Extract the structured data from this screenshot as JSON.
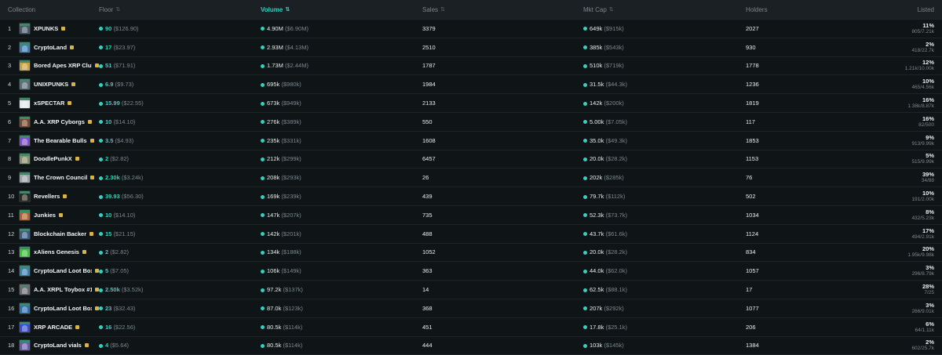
{
  "header": {
    "collection": "Collection",
    "floor": "Floor",
    "volume": "Volume",
    "sales": "Sales",
    "mcap": "Mkt Cap",
    "holders": "Holders",
    "listed": "Listed"
  },
  "rows": [
    {
      "rank": "1",
      "name": "XPUNKS",
      "floor": "90",
      "floor_usd": "($126.90)",
      "volume": "4.90M",
      "volume_usd": "($6.90M)",
      "sales": "3379",
      "mcap": "649k",
      "mcap_usd": "($915k)",
      "holders": "2027",
      "listed_pct": "11%",
      "listed_ratio": "805/7.21k",
      "thumb_color": "#4a5a68"
    },
    {
      "rank": "2",
      "name": "CryptoLand",
      "floor": "17",
      "floor_usd": "($23.97)",
      "volume": "2.93M",
      "volume_usd": "($4.13M)",
      "sales": "2510",
      "mcap": "385k",
      "mcap_usd": "($543k)",
      "holders": "930",
      "listed_pct": "2%",
      "listed_ratio": "418/22.7k",
      "thumb_color": "#3a7fb0"
    },
    {
      "rank": "3",
      "name": "Bored Apes XRP Club",
      "floor": "51",
      "floor_usd": "($71.91)",
      "volume": "1.73M",
      "volume_usd": "($2.44M)",
      "sales": "1787",
      "mcap": "510k",
      "mcap_usd": "($719k)",
      "holders": "1778",
      "listed_pct": "12%",
      "listed_ratio": "1.21k/10.00k",
      "thumb_color": "#c8a23a"
    },
    {
      "rank": "4",
      "name": "UNIXPUNKS",
      "floor": "6.9",
      "floor_usd": "($9.73)",
      "volume": "695k",
      "volume_usd": "($980k)",
      "sales": "1984",
      "mcap": "31.5k",
      "mcap_usd": "($44.3k)",
      "holders": "1236",
      "listed_pct": "10%",
      "listed_ratio": "465/4.56k",
      "thumb_color": "#5b6f7a"
    },
    {
      "rank": "5",
      "name": "xSPECTAR",
      "floor": "15.99",
      "floor_usd": "($22.55)",
      "volume": "673k",
      "volume_usd": "($949k)",
      "sales": "2133",
      "mcap": "142k",
      "mcap_usd": "($200k)",
      "holders": "1819",
      "listed_pct": "16%",
      "listed_ratio": "1.38k/8.87k",
      "thumb_color": "#e4e8ea"
    },
    {
      "rank": "6",
      "name": "A.A. XRP Cyborgs",
      "floor": "10",
      "floor_usd": "($14.10)",
      "volume": "276k",
      "volume_usd": "($389k)",
      "sales": "550",
      "mcap": "5.00k",
      "mcap_usd": "($7.05k)",
      "holders": "117",
      "listed_pct": "16%",
      "listed_ratio": "82/500",
      "thumb_color": "#7a4a2e"
    },
    {
      "rank": "7",
      "name": "The Bearable Bulls",
      "floor": "3.5",
      "floor_usd": "($4.93)",
      "volume": "235k",
      "volume_usd": "($331k)",
      "sales": "1608",
      "mcap": "35.0k",
      "mcap_usd": "($49.3k)",
      "holders": "1853",
      "listed_pct": "9%",
      "listed_ratio": "913/9.99k",
      "thumb_color": "#7b4fc9"
    },
    {
      "rank": "8",
      "name": "DoodlePunkX",
      "floor": "2",
      "floor_usd": "($2.82)",
      "volume": "212k",
      "volume_usd": "($299k)",
      "sales": "6457",
      "mcap": "20.0k",
      "mcap_usd": "($28.2k)",
      "holders": "1153",
      "listed_pct": "5%",
      "listed_ratio": "515/9.99k",
      "thumb_color": "#8a8f6a"
    },
    {
      "rank": "9",
      "name": "The Crown Council",
      "floor": "2.30k",
      "floor_usd": "($3.24k)",
      "volume": "208k",
      "volume_usd": "($293k)",
      "sales": "26",
      "mcap": "202k",
      "mcap_usd": "($285k)",
      "holders": "76",
      "listed_pct": "39%",
      "listed_ratio": "34/88",
      "thumb_color": "#9aa3a8"
    },
    {
      "rank": "10",
      "name": "Revellers",
      "floor": "39.93",
      "floor_usd": "($56.30)",
      "volume": "169k",
      "volume_usd": "($239k)",
      "sales": "439",
      "mcap": "79.7k",
      "mcap_usd": "($112k)",
      "holders": "502",
      "listed_pct": "10%",
      "listed_ratio": "191/2.00k",
      "thumb_color": "#2a2a22"
    },
    {
      "rank": "11",
      "name": "Junkies",
      "floor": "10",
      "floor_usd": "($14.10)",
      "volume": "147k",
      "volume_usd": "($207k)",
      "sales": "735",
      "mcap": "52.3k",
      "mcap_usd": "($73.7k)",
      "holders": "1034",
      "listed_pct": "8%",
      "listed_ratio": "432/5.23k",
      "thumb_color": "#b0602e"
    },
    {
      "rank": "12",
      "name": "Blockchain Backer",
      "floor": "15",
      "floor_usd": "($21.15)",
      "volume": "142k",
      "volume_usd": "($201k)",
      "sales": "488",
      "mcap": "43.7k",
      "mcap_usd": "($61.6k)",
      "holders": "1124",
      "listed_pct": "17%",
      "listed_ratio": "494/2.91k",
      "thumb_color": "#3b5c88"
    },
    {
      "rank": "13",
      "name": "xAliens Genesis",
      "floor": "2",
      "floor_usd": "($2.82)",
      "volume": "134k",
      "volume_usd": "($188k)",
      "sales": "1052",
      "mcap": "20.0k",
      "mcap_usd": "($28.2k)",
      "holders": "834",
      "listed_pct": "20%",
      "listed_ratio": "1.95k/9.98k",
      "thumb_color": "#3fbf3a"
    },
    {
      "rank": "14",
      "name": "CryptoLand Loot Box",
      "floor": "5",
      "floor_usd": "($7.05)",
      "volume": "106k",
      "volume_usd": "($149k)",
      "sales": "363",
      "mcap": "44.0k",
      "mcap_usd": "($62.0k)",
      "holders": "1057",
      "listed_pct": "3%",
      "listed_ratio": "296/8.79k",
      "thumb_color": "#3a7fb0"
    },
    {
      "rank": "15",
      "name": "A.A. XRPL Toybox #1",
      "floor": "2.50k",
      "floor_usd": "($3.52k)",
      "volume": "97.2k",
      "volume_usd": "($137k)",
      "sales": "14",
      "mcap": "62.5k",
      "mcap_usd": "($88.1k)",
      "holders": "17",
      "listed_pct": "28%",
      "listed_ratio": "7/25",
      "thumb_color": "#6a6a70"
    },
    {
      "rank": "16",
      "name": "CryptoLand Loot Box K...",
      "floor": "23",
      "floor_usd": "($32.43)",
      "volume": "87.0k",
      "volume_usd": "($123k)",
      "sales": "368",
      "mcap": "207k",
      "mcap_usd": "($292k)",
      "holders": "1077",
      "listed_pct": "3%",
      "listed_ratio": "266/9.01k",
      "thumb_color": "#2f6fb3"
    },
    {
      "rank": "17",
      "name": "XRP ARCADE",
      "floor": "16",
      "floor_usd": "($22.56)",
      "volume": "80.5k",
      "volume_usd": "($114k)",
      "sales": "451",
      "mcap": "17.8k",
      "mcap_usd": "($25.1k)",
      "holders": "206",
      "listed_pct": "6%",
      "listed_ratio": "64/1.11k",
      "thumb_color": "#3b4dd0"
    },
    {
      "rank": "18",
      "name": "CryptoLand vials",
      "floor": "4",
      "floor_usd": "($5.64)",
      "volume": "80.5k",
      "volume_usd": "($114k)",
      "sales": "444",
      "mcap": "103k",
      "mcap_usd": "($145k)",
      "holders": "1384",
      "listed_pct": "2%",
      "listed_ratio": "602/25.7k",
      "thumb_color": "#6e5aa8"
    }
  ],
  "colors": {
    "accent": "#2ad4c4",
    "background": "#0f1416",
    "verified": "#d8b448"
  },
  "icons": {
    "sort": "sort-arrows-icon",
    "xrp_token": "token-dot-icon",
    "verified": "verified-badge-icon"
  }
}
